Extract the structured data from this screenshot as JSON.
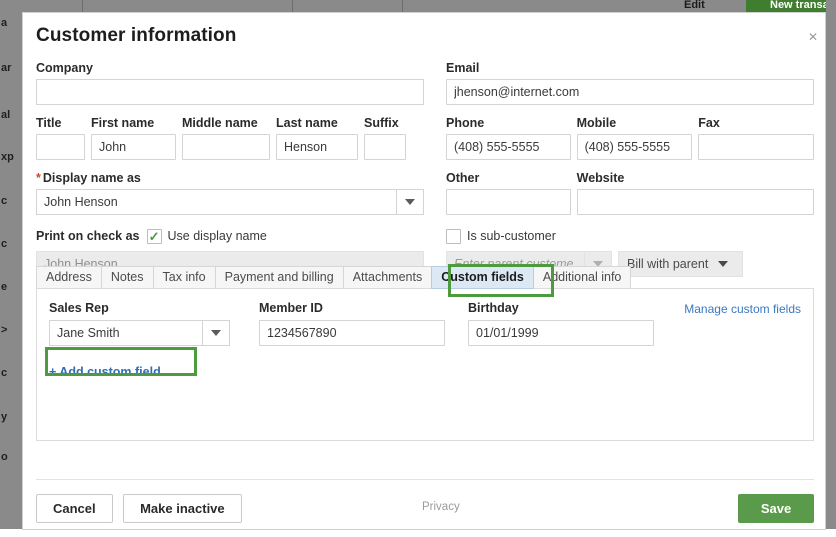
{
  "background": {
    "left_fragments": [
      "a",
      "ar",
      "al",
      "xp",
      "c",
      "c",
      "e",
      ">",
      "c",
      "y",
      "o"
    ],
    "top_items": [
      "Edit",
      "New transac"
    ]
  },
  "modal": {
    "title": "Customer information",
    "close_icon": "close-icon"
  },
  "fields": {
    "company": {
      "label": "Company",
      "value": ""
    },
    "title": {
      "label": "Title",
      "value": ""
    },
    "first_name": {
      "label": "First name",
      "value": "John"
    },
    "middle_name": {
      "label": "Middle name",
      "value": ""
    },
    "last_name": {
      "label": "Last name",
      "value": "Henson"
    },
    "suffix": {
      "label": "Suffix",
      "value": ""
    },
    "display_name": {
      "label": "Display name as",
      "required_mark": "*",
      "value": "John Henson"
    },
    "print_on_check": {
      "label": "Print on check as",
      "checkbox_label": "Use display name",
      "checked": true,
      "check_glyph": "✓",
      "value": "John Henson"
    },
    "email": {
      "label": "Email",
      "value": "jhenson@internet.com"
    },
    "phone": {
      "label": "Phone",
      "value": "(408) 555-5555"
    },
    "mobile": {
      "label": "Mobile",
      "value": "(408) 555-5555"
    },
    "fax": {
      "label": "Fax",
      "value": ""
    },
    "other": {
      "label": "Other",
      "value": ""
    },
    "website": {
      "label": "Website",
      "value": ""
    },
    "is_sub_customer": {
      "label": "Is sub-customer",
      "checked": false
    },
    "parent_customer": {
      "placeholder": "Enter parent custome",
      "value": ""
    },
    "bill_with_parent": {
      "value": "Bill with parent"
    }
  },
  "tabs": [
    {
      "label": "Address",
      "active": false
    },
    {
      "label": "Notes",
      "active": false
    },
    {
      "label": "Tax info",
      "active": false
    },
    {
      "label": "Payment and billing",
      "active": false
    },
    {
      "label": "Attachments",
      "active": false
    },
    {
      "label": "Custom fields",
      "active": true
    },
    {
      "label": "Additional info",
      "active": false
    }
  ],
  "custom_fields": {
    "manage_link": "Manage custom fields",
    "add_link": "+ Add custom field",
    "items": [
      {
        "label": "Sales Rep",
        "value": "Jane Smith",
        "type": "select"
      },
      {
        "label": "Member ID",
        "value": "1234567890",
        "type": "text"
      },
      {
        "label": "Birthday",
        "value": "01/01/1999",
        "type": "text"
      }
    ]
  },
  "footer": {
    "cancel": "Cancel",
    "make_inactive": "Make inactive",
    "privacy": "Privacy",
    "save": "Save"
  },
  "colors": {
    "annotation_green": "#4e9a3f",
    "save_green": "#5a9a4b",
    "active_tab_blue": "#dce9f5",
    "link_blue": "#2e6db4",
    "required_red": "#d0472b"
  }
}
